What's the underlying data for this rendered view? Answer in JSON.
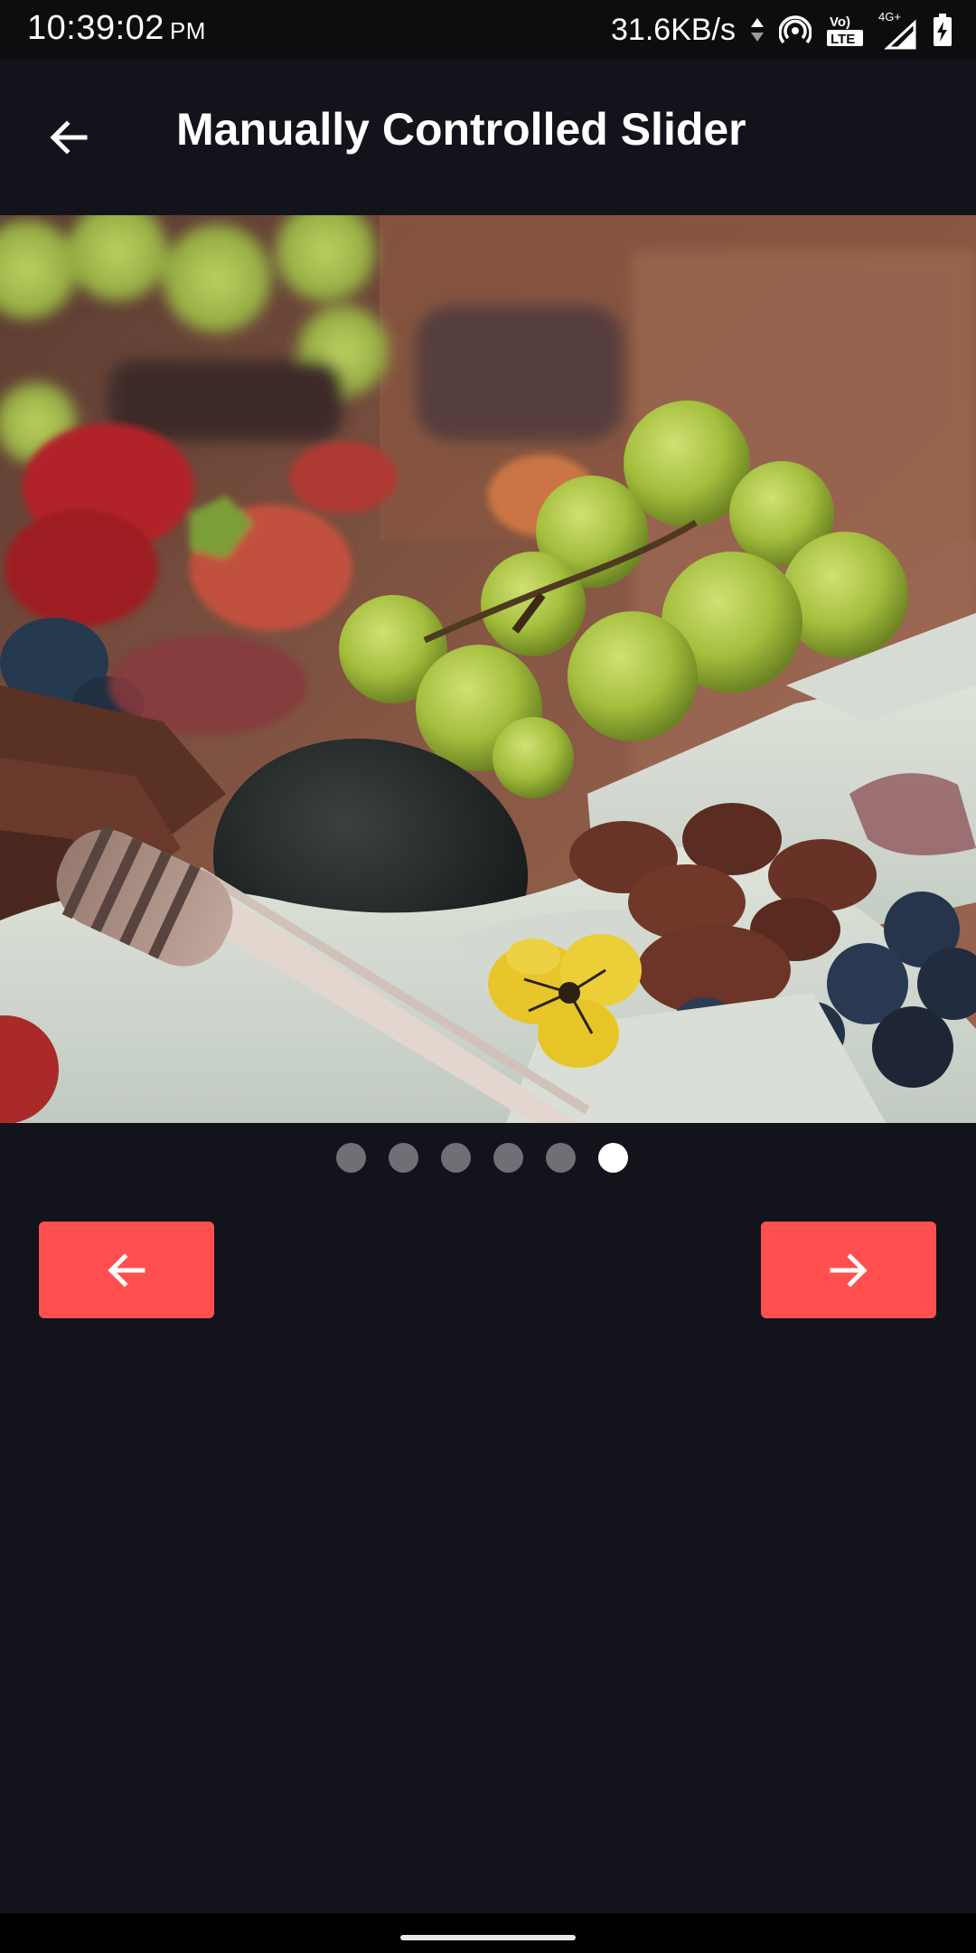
{
  "status_bar": {
    "time": "10:39:02",
    "ampm": "PM",
    "network_speed": "31.6KB/s",
    "icons": [
      "data-arrows-icon",
      "hotspot-icon",
      "volte-icon",
      "signal-4g-icon",
      "battery-charging-icon"
    ],
    "volte_label_top": "Vo)",
    "volte_label_bottom": "LTE",
    "network_type": "4G+"
  },
  "app_bar": {
    "title": "Manually Controlled Slider",
    "back_icon": "arrow-left-icon"
  },
  "slider": {
    "image_description_icon": "food-platter-image",
    "total_slides": 6,
    "active_index": 5
  },
  "controls": {
    "prev_icon": "arrow-left-icon",
    "next_icon": "arrow-right-icon"
  },
  "colors": {
    "background": "#13131c",
    "accent": "#ff4f4f",
    "dot_inactive": "#6f6f76",
    "dot_active": "#ffffff"
  }
}
